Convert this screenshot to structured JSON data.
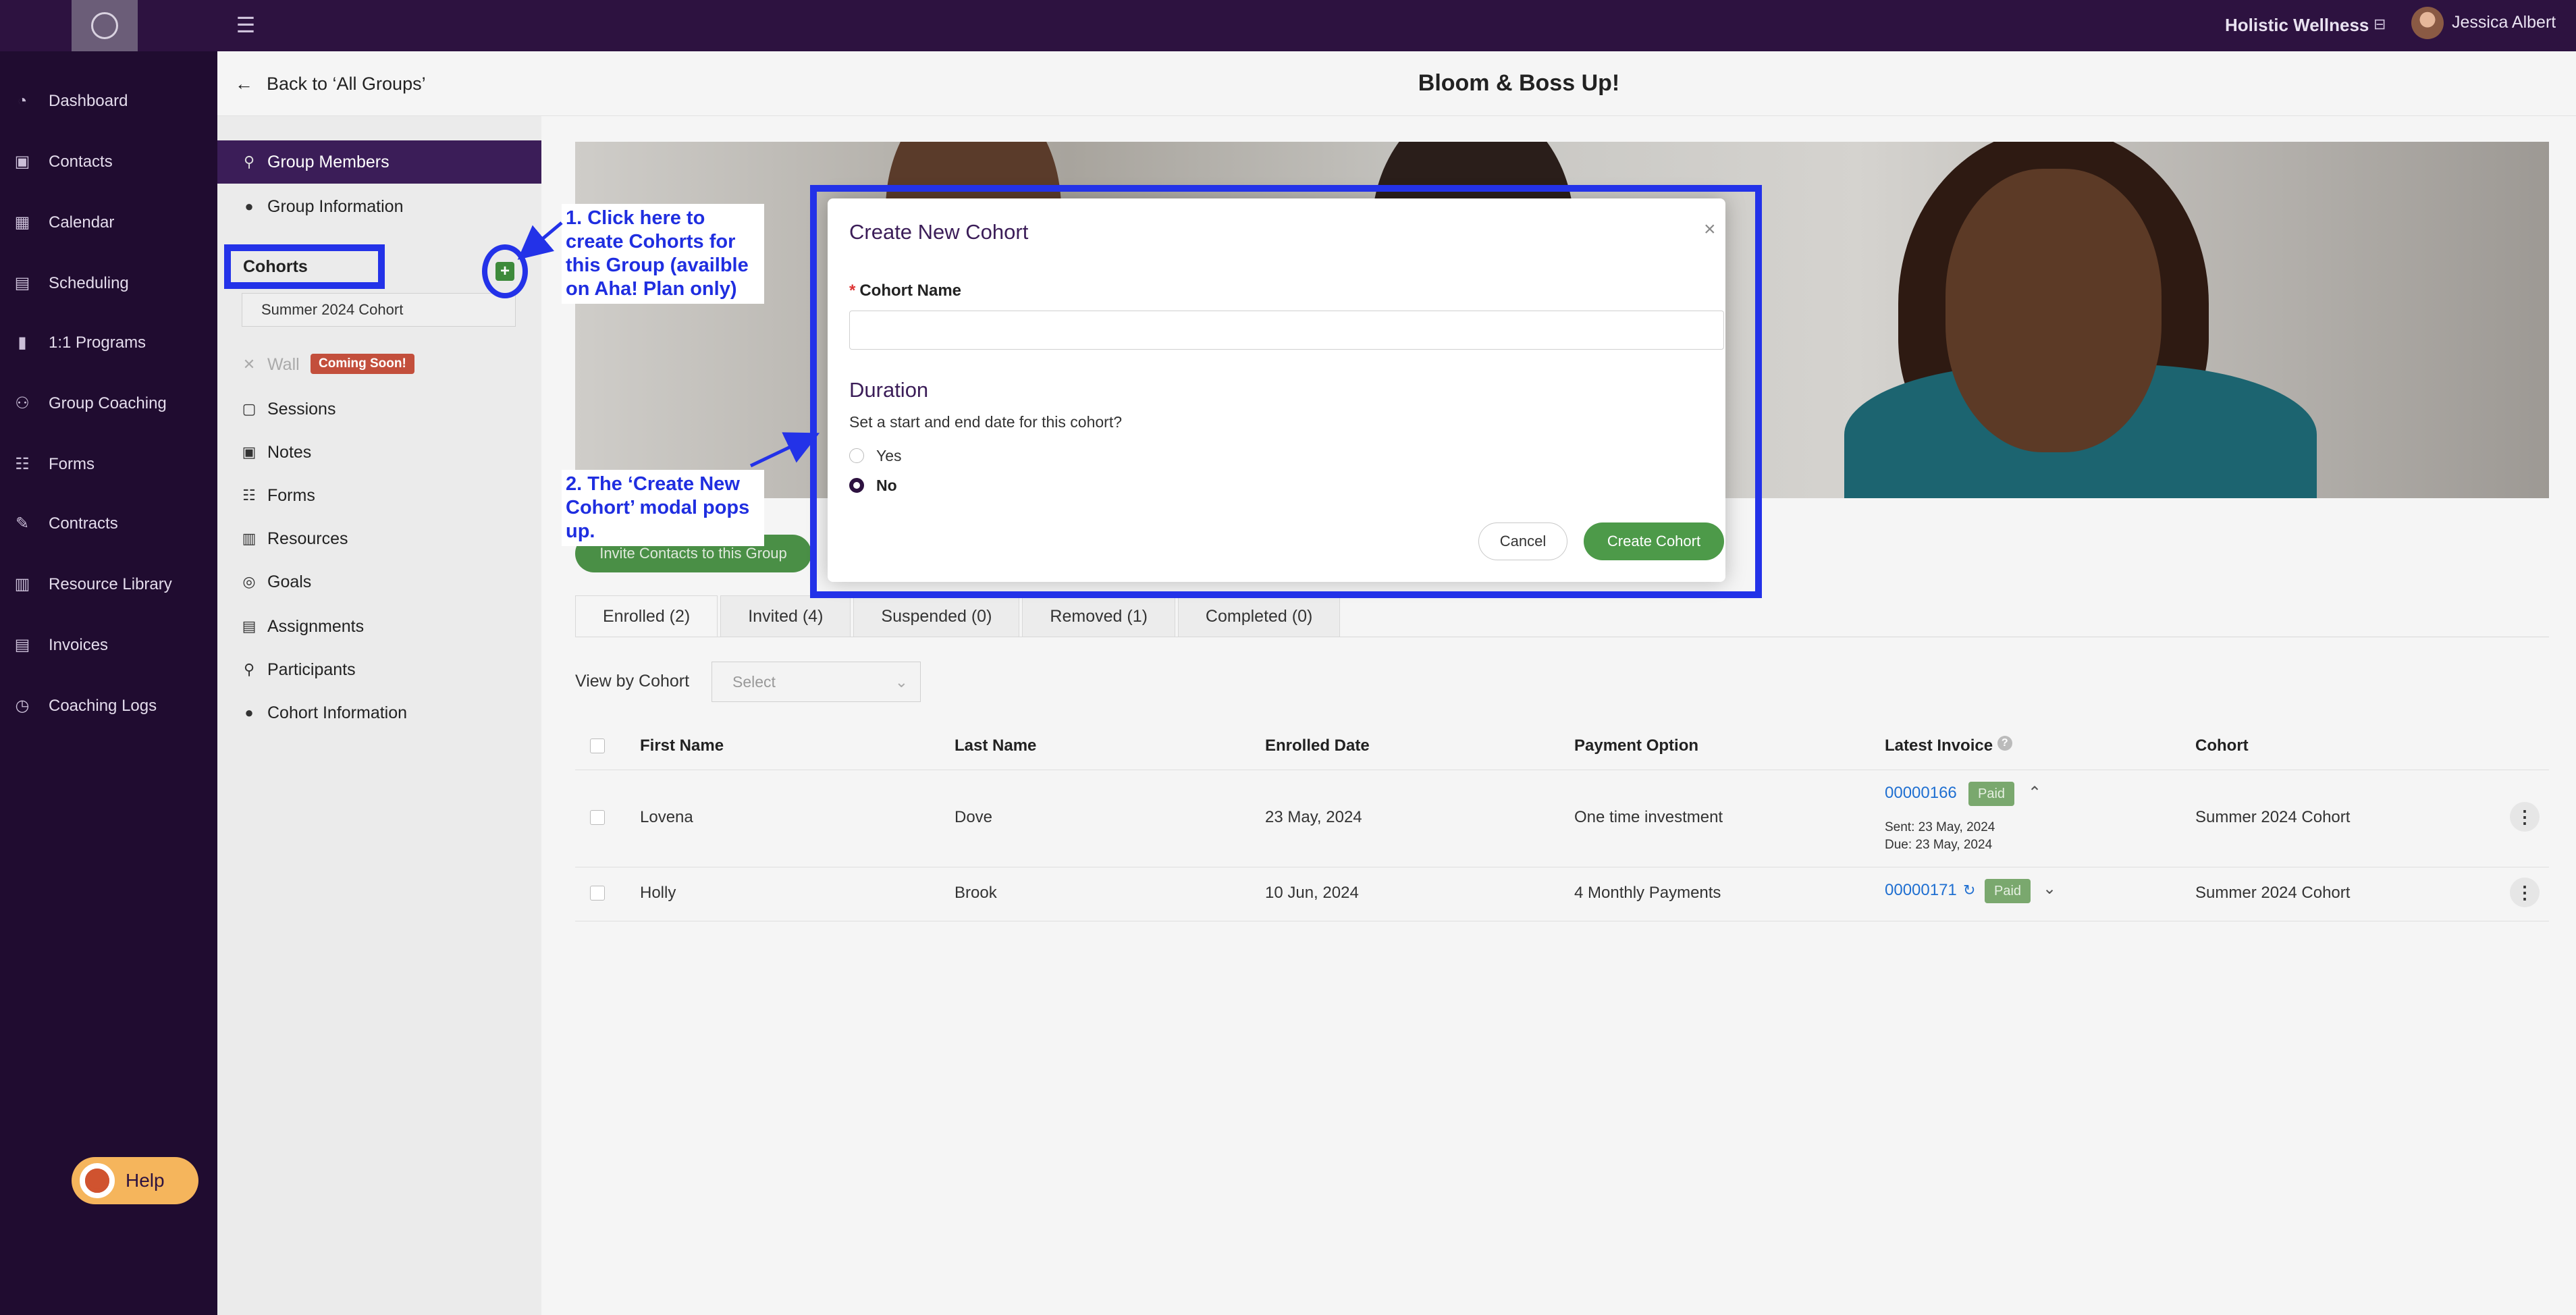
{
  "topbar": {
    "org_name": "Holistic Wellness",
    "user_name": "Jessica Albert"
  },
  "sidebar": {
    "items": [
      {
        "label": "Dashboard",
        "icon": "dashboard-icon"
      },
      {
        "label": "Contacts",
        "icon": "contacts-icon"
      },
      {
        "label": "Calendar",
        "icon": "calendar-icon"
      },
      {
        "label": "Scheduling",
        "icon": "scheduling-icon"
      },
      {
        "label": "1:1 Programs",
        "icon": "programs-icon"
      },
      {
        "label": "Group Coaching",
        "icon": "group-icon"
      },
      {
        "label": "Forms",
        "icon": "forms-icon"
      },
      {
        "label": "Contracts",
        "icon": "contracts-icon"
      },
      {
        "label": "Resource Library",
        "icon": "library-icon"
      },
      {
        "label": "Invoices",
        "icon": "invoices-icon"
      },
      {
        "label": "Coaching Logs",
        "icon": "clock-icon"
      }
    ],
    "help_label": "Help"
  },
  "header": {
    "back_label": "Back to ‘All Groups’",
    "title": "Bloom & Boss Up!"
  },
  "group_nav": {
    "members": "Group Members",
    "information": "Group Information",
    "cohorts_label": "Cohorts",
    "cohort_selected": "Summer 2024 Cohort",
    "wall": "Wall",
    "coming_soon": "Coming Soon!",
    "items": [
      "Sessions",
      "Notes",
      "Forms",
      "Resources",
      "Goals",
      "Assignments",
      "Participants",
      "Cohort Information"
    ]
  },
  "main": {
    "invite_label": "Invite Contacts to this Group",
    "tabs": [
      "Enrolled (2)",
      "Invited (4)",
      "Suspended (0)",
      "Removed (1)",
      "Completed (0)"
    ],
    "filter_label": "View by Cohort",
    "filter_placeholder": "Select",
    "table": {
      "headers": [
        "First Name",
        "Last Name",
        "Enrolled Date",
        "Payment Option",
        "Latest Invoice",
        "Cohort"
      ],
      "rows": [
        {
          "first": "Lovena",
          "last": "Dove",
          "enrolled": "23 May, 2024",
          "payment": "One time investment",
          "invoice": "00000166",
          "status": "Paid",
          "sent": "Sent: 23 May, 2024",
          "due": "Due: 23 May, 2024",
          "cohort": "Summer 2024 Cohort"
        },
        {
          "first": "Holly",
          "last": "Brook",
          "enrolled": "10 Jun, 2024",
          "payment": "4 Monthly Payments",
          "invoice": "00000171",
          "status": "Paid",
          "cohort": "Summer 2024 Cohort"
        }
      ]
    }
  },
  "modal": {
    "title": "Create New Cohort",
    "field_label": "Cohort Name",
    "field_value": "",
    "duration_title": "Duration",
    "duration_question": "Set a start and end date for this cohort?",
    "option_yes": "Yes",
    "option_no": "No",
    "selected": "No",
    "cancel": "Cancel",
    "create": "Create Cohort"
  },
  "annotations": {
    "note1": "1. Click here to create Cohorts for this Group (availble on Aha! Plan only)",
    "note2": "2. The ‘Create New Cohort’ modal pops up."
  },
  "colors": {
    "topbar": "#2d1240",
    "sidebar": "#200c30",
    "accent_green": "#4d9a49",
    "annotation_blue": "#2332e8",
    "link_blue": "#1f6fd1"
  }
}
